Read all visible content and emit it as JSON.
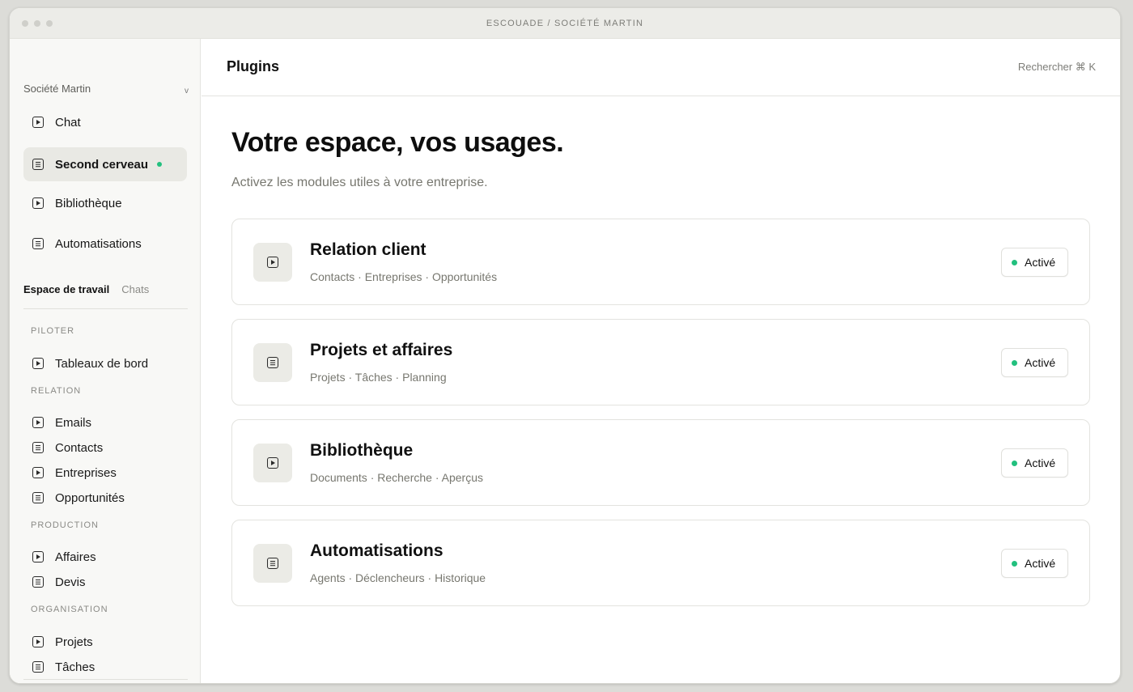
{
  "window": {
    "title": "ESCOUADE / SOCIÉTÉ MARTIN"
  },
  "sidebar": {
    "workspace": "Société Martin",
    "workspace_chevron": "v",
    "nav": [
      {
        "label": "Chat",
        "icon": "play-square-icon"
      },
      {
        "label": "Second cerveau",
        "icon": "document-icon",
        "active": true,
        "status": "active-dot"
      },
      {
        "label": "Bibliothèque",
        "icon": "play-square-icon"
      },
      {
        "label": "Automatisations",
        "icon": "document-icon"
      }
    ],
    "tabs": {
      "workspace": "Espace de travail",
      "chats": "Chats"
    },
    "sections": [
      {
        "label": "PILOTER",
        "items": [
          "Tableaux de bord"
        ]
      },
      {
        "label": "RELATION",
        "items": [
          "Emails",
          "Contacts",
          "Entreprises",
          "Opportunités"
        ]
      },
      {
        "label": "PRODUCTION",
        "items": [
          "Affaires",
          "Devis"
        ]
      },
      {
        "label": "ORGANISATION",
        "items": [
          "Projets",
          "Tâches"
        ]
      }
    ]
  },
  "topbar": {
    "title": "Plugins",
    "search": "Rechercher ⌘ K"
  },
  "main": {
    "title": "Votre espace, vos usages.",
    "subtitle": "Activez les modules utiles à votre entreprise.",
    "plugins": [
      {
        "title": "Relation client",
        "subtitle": "Contacts · Entreprises · Opportunités",
        "status": "Activé",
        "icon": "play-square-icon"
      },
      {
        "title": "Projets et affaires",
        "subtitle": "Projets · Tâches · Planning",
        "status": "Activé",
        "icon": "document-icon"
      },
      {
        "title": "Bibliothèque",
        "subtitle": "Documents · Recherche · Aperçus",
        "status": "Activé",
        "icon": "play-square-icon"
      },
      {
        "title": "Automatisations",
        "subtitle": "Agents · Déclencheurs · Historique",
        "status": "Activé",
        "icon": "document-icon"
      }
    ]
  },
  "colors": {
    "accent_green": "#22c07e",
    "sidebar_bg": "#f8f8f6",
    "active_bg": "#e9e9e4"
  }
}
